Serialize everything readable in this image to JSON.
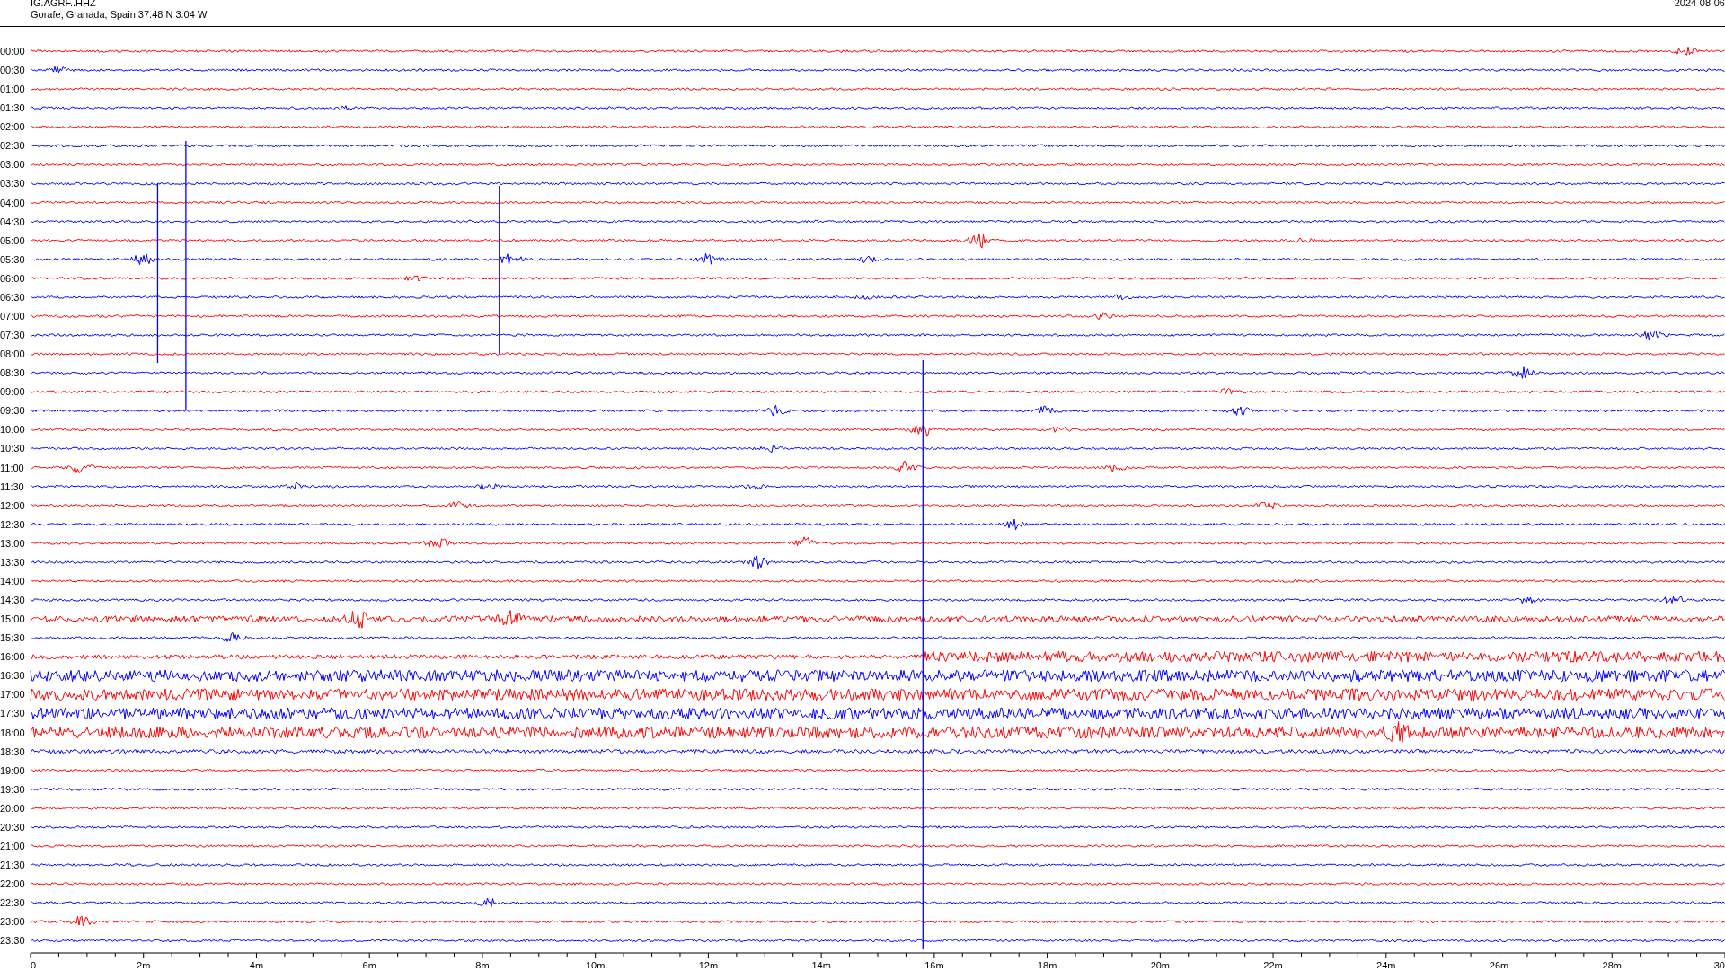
{
  "header": {
    "station": "IG.AGRF..HHZ",
    "location": "Gorafe, Granada, Spain  37.48 N 3.04 W",
    "date": "2024-08-06"
  },
  "rows": [
    {
      "time": "00:00",
      "color": "#ff0000"
    },
    {
      "time": "00:30",
      "color": "#0000ff"
    },
    {
      "time": "01:00",
      "color": "#ff0000"
    },
    {
      "time": "01:30",
      "color": "#0000ff"
    },
    {
      "time": "02:00",
      "color": "#ff0000"
    },
    {
      "time": "02:30",
      "color": "#0000ff"
    },
    {
      "time": "03:00",
      "color": "#ff0000"
    },
    {
      "time": "03:30",
      "color": "#0000ff"
    },
    {
      "time": "04:00",
      "color": "#ff0000"
    },
    {
      "time": "04:30",
      "color": "#0000ff"
    },
    {
      "time": "05:00",
      "color": "#ff0000"
    },
    {
      "time": "05:30",
      "color": "#0000ff"
    },
    {
      "time": "06:00",
      "color": "#ff0000"
    },
    {
      "time": "06:30",
      "color": "#0000ff"
    },
    {
      "time": "07:00",
      "color": "#ff0000"
    },
    {
      "time": "07:30",
      "color": "#0000ff"
    },
    {
      "time": "08:00",
      "color": "#ff0000"
    },
    {
      "time": "08:30",
      "color": "#0000ff"
    },
    {
      "time": "09:00",
      "color": "#ff0000"
    },
    {
      "time": "09:30",
      "color": "#0000ff"
    },
    {
      "time": "10:00",
      "color": "#ff0000"
    },
    {
      "time": "10:30",
      "color": "#0000ff"
    },
    {
      "time": "11:00",
      "color": "#ff0000"
    },
    {
      "time": "11:30",
      "color": "#0000ff"
    },
    {
      "time": "12:00",
      "color": "#ff0000"
    },
    {
      "time": "12:30",
      "color": "#0000ff"
    },
    {
      "time": "13:00",
      "color": "#ff0000"
    },
    {
      "time": "13:30",
      "color": "#0000ff"
    },
    {
      "time": "14:00",
      "color": "#ff0000"
    },
    {
      "time": "14:30",
      "color": "#0000ff"
    },
    {
      "time": "15:00",
      "color": "#ff0000"
    },
    {
      "time": "15:30",
      "color": "#0000ff"
    },
    {
      "time": "16:00",
      "color": "#ff0000"
    },
    {
      "time": "16:30",
      "color": "#0000ff"
    },
    {
      "time": "17:00",
      "color": "#ff0000"
    },
    {
      "time": "17:30",
      "color": "#0000ff"
    },
    {
      "time": "18:00",
      "color": "#ff0000"
    },
    {
      "time": "18:30",
      "color": "#0000ff"
    },
    {
      "time": "19:00",
      "color": "#ff0000"
    },
    {
      "time": "19:30",
      "color": "#0000ff"
    },
    {
      "time": "20:00",
      "color": "#ff0000"
    },
    {
      "time": "20:30",
      "color": "#0000ff"
    },
    {
      "time": "21:00",
      "color": "#ff0000"
    },
    {
      "time": "21:30",
      "color": "#0000ff"
    },
    {
      "time": "22:00",
      "color": "#ff0000"
    },
    {
      "time": "22:30",
      "color": "#0000ff"
    },
    {
      "time": "23:00",
      "color": "#ff0000"
    },
    {
      "time": "23:30",
      "color": "#0000ff"
    }
  ],
  "x_axis": {
    "labels": [
      "0",
      "2m",
      "4m",
      "6m",
      "8m",
      "10m",
      "12m",
      "14m",
      "16m",
      "18m",
      "20m",
      "22m",
      "24m",
      "26m",
      "28m",
      "30"
    ]
  }
}
